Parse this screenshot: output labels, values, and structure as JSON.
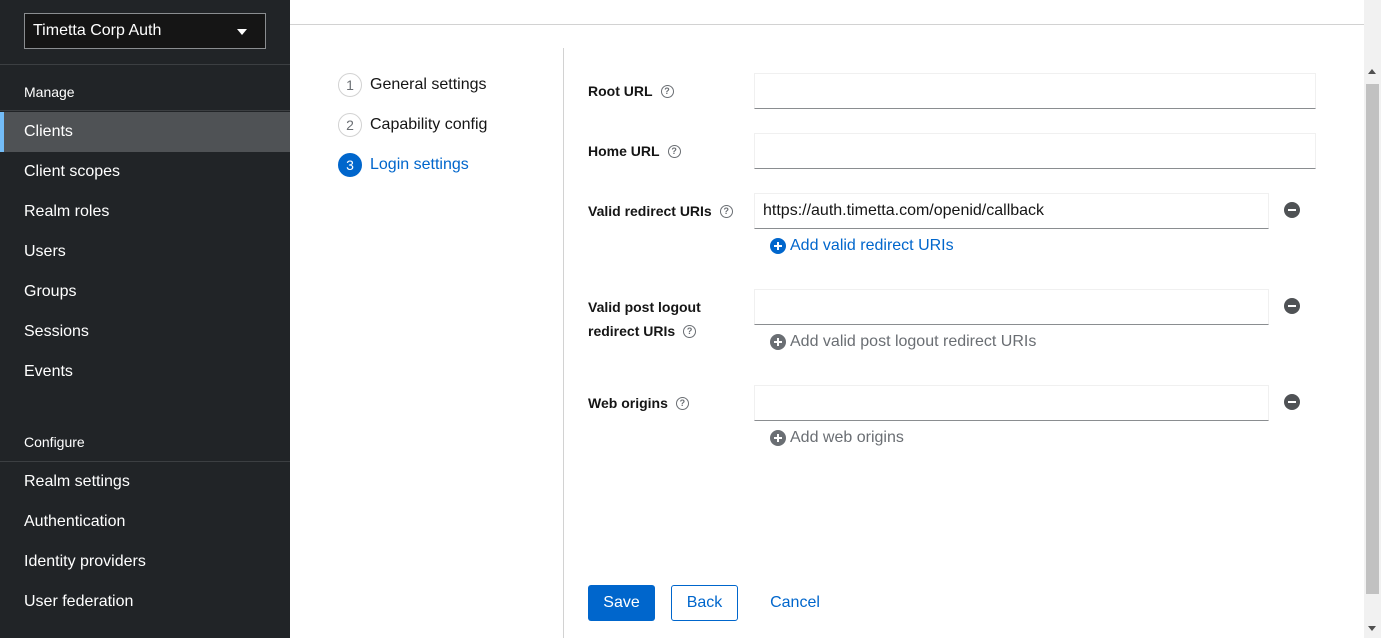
{
  "sidebar": {
    "realm": "Timetta Corp Auth",
    "manage_title": "Manage",
    "manage_items": [
      {
        "label": "Clients"
      },
      {
        "label": "Client scopes"
      },
      {
        "label": "Realm roles"
      },
      {
        "label": "Users"
      },
      {
        "label": "Groups"
      },
      {
        "label": "Sessions"
      },
      {
        "label": "Events"
      }
    ],
    "configure_title": "Configure",
    "configure_items": [
      {
        "label": "Realm settings"
      },
      {
        "label": "Authentication"
      },
      {
        "label": "Identity providers"
      },
      {
        "label": "User federation"
      }
    ]
  },
  "wizard": {
    "steps": [
      {
        "num": "1",
        "label": "General settings"
      },
      {
        "num": "2",
        "label": "Capability config"
      },
      {
        "num": "3",
        "label": "Login settings"
      }
    ],
    "current_step": 3
  },
  "form": {
    "root_url": {
      "label": "Root URL",
      "value": ""
    },
    "home_url": {
      "label": "Home URL",
      "value": ""
    },
    "valid_redirect": {
      "label": "Valid redirect URIs",
      "value": "https://auth.timetta.com/openid/callback",
      "add_label": "Add valid redirect URIs"
    },
    "post_logout": {
      "label_line1": "Valid post logout",
      "label_line2": "redirect URIs",
      "value": "",
      "add_label": "Add valid post logout redirect URIs"
    },
    "web_origins": {
      "label": "Web origins",
      "value": "",
      "add_label": "Add web origins"
    },
    "help_glyph": "?"
  },
  "actions": {
    "save": "Save",
    "back": "Back",
    "cancel": "Cancel"
  },
  "colors": {
    "accent": "#0066cc",
    "sidebar_bg": "#212427",
    "active_nav": "#4f5255",
    "active_indicator": "#73bcf7"
  }
}
